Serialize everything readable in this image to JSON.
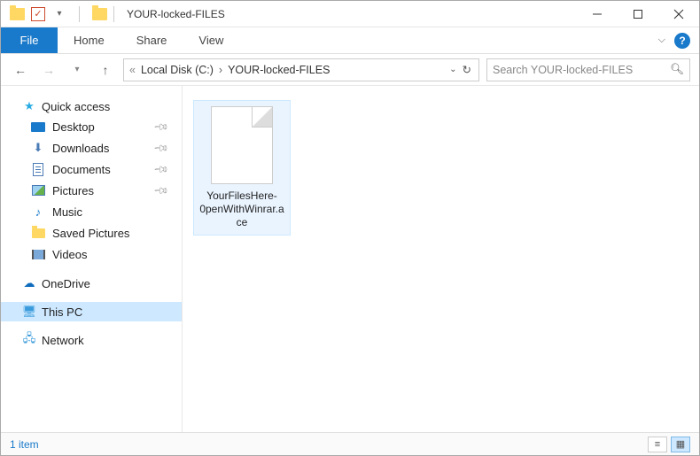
{
  "title": "YOUR-locked-FILES",
  "ribbon": {
    "file": "File",
    "tabs": [
      "Home",
      "Share",
      "View"
    ]
  },
  "breadcrumb": {
    "items": [
      "Local Disk (C:)",
      "YOUR-locked-FILES"
    ]
  },
  "search": {
    "placeholder": "Search YOUR-locked-FILES"
  },
  "sidebar": {
    "quick_access": "Quick access",
    "items": [
      {
        "label": "Desktop",
        "pinned": true
      },
      {
        "label": "Downloads",
        "pinned": true
      },
      {
        "label": "Documents",
        "pinned": true
      },
      {
        "label": "Pictures",
        "pinned": true
      },
      {
        "label": "Music",
        "pinned": false
      },
      {
        "label": "Saved Pictures",
        "pinned": false
      },
      {
        "label": "Videos",
        "pinned": false
      }
    ],
    "onedrive": "OneDrive",
    "this_pc": "This PC",
    "network": "Network"
  },
  "files": [
    {
      "name": "YourFilesHere-0penWithWinrar.ace"
    }
  ],
  "status": {
    "count_text": "1 item"
  }
}
